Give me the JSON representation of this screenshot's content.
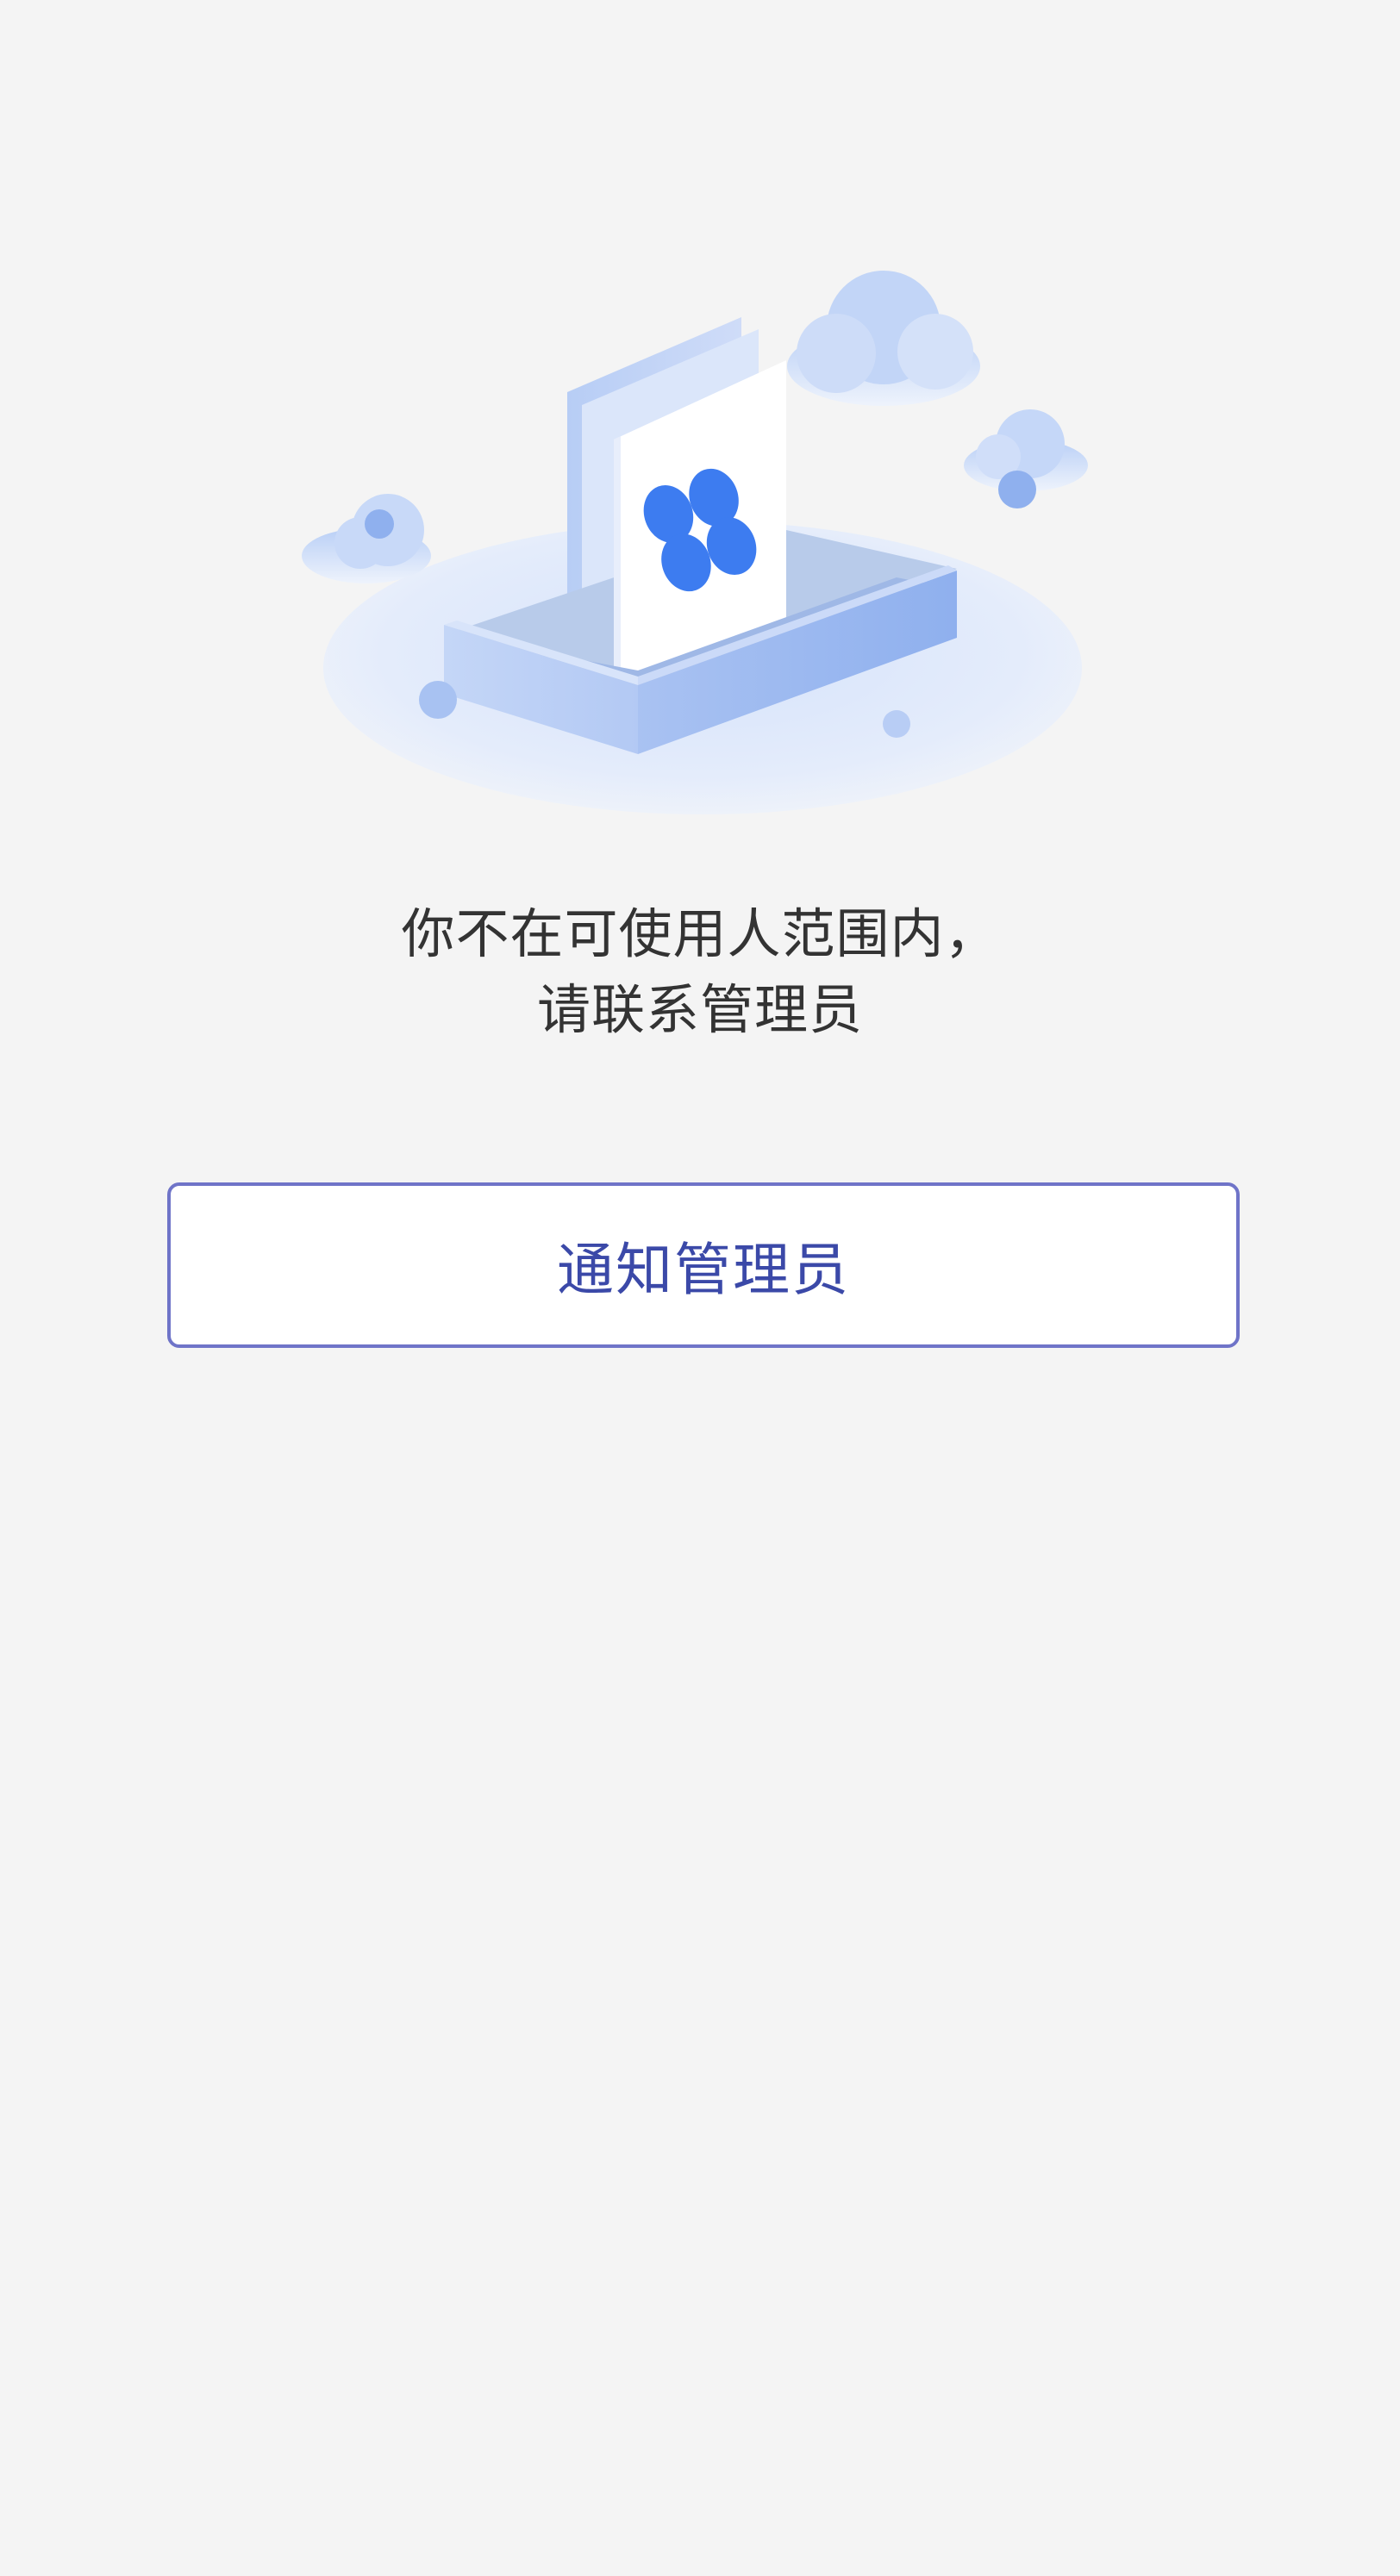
{
  "empty_state": {
    "illustration": "document-in-tray-with-clouds-illustration",
    "message_line_1": "你不在可使用人范围内，",
    "message_line_2": "请联系管理员"
  },
  "actions": {
    "notify_admin_label": "通知管理员"
  },
  "colors": {
    "background": "#f4f4f4",
    "message_text": "#333333",
    "button_border": "#6f74c8",
    "button_text": "#3b49a8",
    "illustration_blue": "#3d7cf0"
  }
}
